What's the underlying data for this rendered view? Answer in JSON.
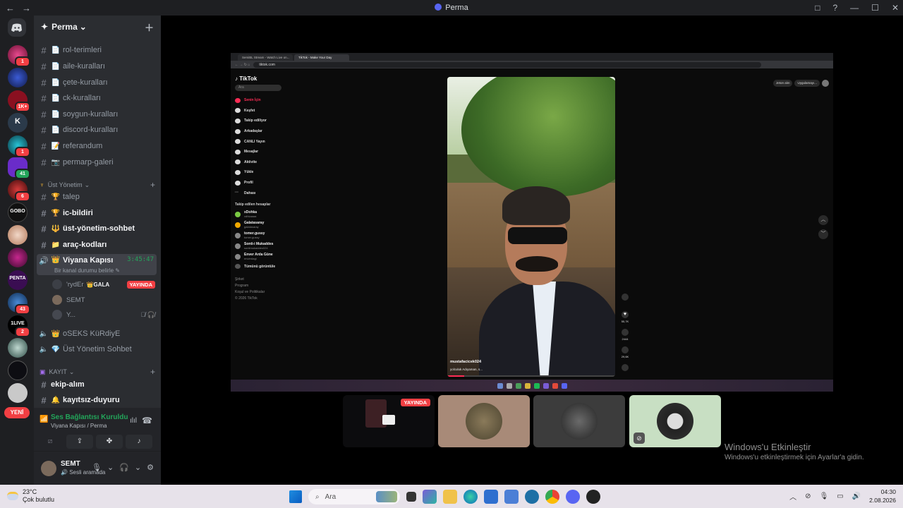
{
  "window": {
    "title": "Perma",
    "controls": [
      "□",
      "?",
      "—",
      "☐",
      "✕"
    ]
  },
  "servers": [
    {
      "badge": "1"
    },
    {
      "badge": ""
    },
    {
      "badge": "1K+"
    },
    {
      "badge": ""
    },
    {
      "badge": "1"
    },
    {
      "badge": "41"
    },
    {
      "badge": "6"
    },
    {
      "badge": ""
    },
    {
      "badge": ""
    },
    {
      "badge": ""
    },
    {
      "badge": ""
    },
    {
      "badge": "43"
    },
    {
      "badge": "2"
    },
    {
      "badge": ""
    },
    {
      "badge": ""
    }
  ],
  "server_labels": {
    "penta": "PENTA",
    "live": "1LIVE",
    "gobo": "GOBO"
  },
  "new_label": "YENİ",
  "guild": {
    "name": "Perma"
  },
  "channels": {
    "text1": [
      {
        "emoji": "📄",
        "name": "rol-terimleri"
      },
      {
        "emoji": "📄",
        "name": "aile-kuralları"
      },
      {
        "emoji": "📄",
        "name": "çete-kuralları"
      },
      {
        "emoji": "📄",
        "name": "ck-kuralları"
      },
      {
        "emoji": "📄",
        "name": "soygun-kuralları"
      },
      {
        "emoji": "📄",
        "name": "discord-kuralları"
      },
      {
        "emoji": "📝",
        "name": "referandum"
      },
      {
        "emoji": "📷",
        "name": "permarp-galeri"
      }
    ],
    "category1": "Üst Yönetim",
    "text2": [
      {
        "emoji": "🏆",
        "name": "talep"
      },
      {
        "emoji": "🏆",
        "name": "ic-bildiri"
      },
      {
        "emoji": "🔱",
        "name": "üst-yönetim-sohbet"
      },
      {
        "emoji": "📁",
        "name": "araç-kodları"
      }
    ],
    "voice_active": {
      "name": "Viyana Kapısı",
      "timer": "3:45:47",
      "status": "Bir kanal durumu belirle"
    },
    "voice_users": [
      {
        "name": "'rydEr",
        "tag": "GALA",
        "live": "YAYINDA"
      },
      {
        "name": "SEMT"
      },
      {
        "name": "Y..."
      }
    ],
    "voice_other": [
      {
        "emoji": "👑",
        "name": "oSEKS KüRdiyE"
      },
      {
        "emoji": "💎",
        "name": "Üst Yönetim Sohbet"
      }
    ],
    "category2": "KAYIT",
    "text3": [
      {
        "name": "ekip-alım"
      },
      {
        "emoji": "🔔",
        "name": "kayıtsız-duyuru"
      }
    ]
  },
  "voice_panel": {
    "status": "Ses Bağlantısı Kuruldu",
    "sub": "Viyana Kapısı / Perma"
  },
  "user": {
    "name": "SEMT",
    "status": "Sesli aramada"
  },
  "stream": {
    "browser_tabs": [
      "SemiBL Stream - Watch Live on...",
      "TikTok - Make Your Day"
    ],
    "url": "tiktok.com",
    "tiktok": {
      "logo": "TikTok",
      "search_placeholder": "Ara",
      "nav": [
        "Senin İçin",
        "Keşfet",
        "Takip ediliyor",
        "Arkadaşlar",
        "CANLI Yayın",
        "Mesajlar",
        "Aktivite",
        "Yükle",
        "Profil",
        "Dahası"
      ],
      "following_header": "Takip edilen hesaplar",
      "accounts": [
        {
          "name": "xDohka",
          "handle": "xdhkaaaa"
        },
        {
          "name": "Galatasaray",
          "handle": "galatasaray"
        },
        {
          "name": "tomer.gussy",
          "handle": "tomer.gussy"
        },
        {
          "name": "Sonti-i Mukaddes",
          "handle": "sontimukaddes024"
        },
        {
          "name": "Enver Arda Güne",
          "handle": "enverdagi"
        }
      ],
      "see_all": "Tümünü görüntüle",
      "footer": [
        "Şirket",
        "Program",
        "Koşul ve Politikalar",
        "© 2026 TikTok"
      ],
      "top_buttons": [
        "Jeton alın",
        "Uygulamayı..."
      ],
      "video_user": "mustafacicek024",
      "video_caption": "yolculuk Adıyaman, s...",
      "counts": [
        "55,7K",
        "2444",
        "29,6K"
      ]
    }
  },
  "thumbs": [
    {
      "live": "YAYINDA"
    }
  ],
  "watermark": {
    "title": "Windows'u Etkinleştir",
    "sub": "Windows'u etkinleştirmek için Ayarlar'a gidin."
  },
  "taskbar": {
    "temp": "23°C",
    "weather": "Çok bulutlu",
    "search": "Ara",
    "time": "04:30",
    "date": "2.08.2026"
  },
  "colors": {
    "discord_blurple": "#5865f2",
    "live_red": "#f23f43",
    "online_green": "#23a55a"
  }
}
